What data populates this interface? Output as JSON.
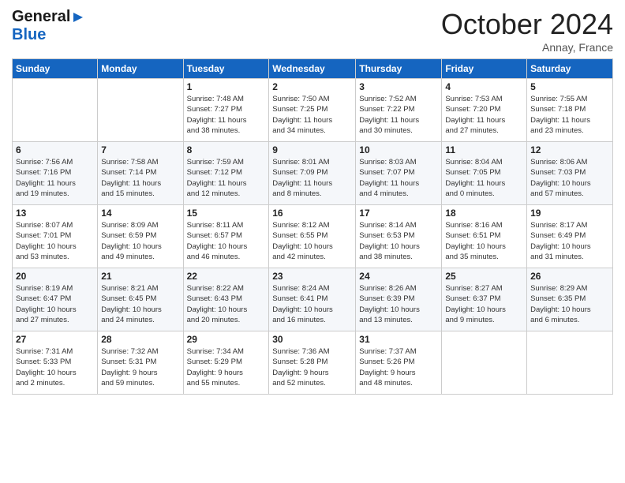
{
  "header": {
    "logo_general": "General",
    "logo_blue": "Blue",
    "month_title": "October 2024",
    "location": "Annay, France"
  },
  "weekdays": [
    "Sunday",
    "Monday",
    "Tuesday",
    "Wednesday",
    "Thursday",
    "Friday",
    "Saturday"
  ],
  "weeks": [
    [
      {
        "day": "",
        "info": ""
      },
      {
        "day": "",
        "info": ""
      },
      {
        "day": "1",
        "info": "Sunrise: 7:48 AM\nSunset: 7:27 PM\nDaylight: 11 hours\nand 38 minutes."
      },
      {
        "day": "2",
        "info": "Sunrise: 7:50 AM\nSunset: 7:25 PM\nDaylight: 11 hours\nand 34 minutes."
      },
      {
        "day": "3",
        "info": "Sunrise: 7:52 AM\nSunset: 7:22 PM\nDaylight: 11 hours\nand 30 minutes."
      },
      {
        "day": "4",
        "info": "Sunrise: 7:53 AM\nSunset: 7:20 PM\nDaylight: 11 hours\nand 27 minutes."
      },
      {
        "day": "5",
        "info": "Sunrise: 7:55 AM\nSunset: 7:18 PM\nDaylight: 11 hours\nand 23 minutes."
      }
    ],
    [
      {
        "day": "6",
        "info": "Sunrise: 7:56 AM\nSunset: 7:16 PM\nDaylight: 11 hours\nand 19 minutes."
      },
      {
        "day": "7",
        "info": "Sunrise: 7:58 AM\nSunset: 7:14 PM\nDaylight: 11 hours\nand 15 minutes."
      },
      {
        "day": "8",
        "info": "Sunrise: 7:59 AM\nSunset: 7:12 PM\nDaylight: 11 hours\nand 12 minutes."
      },
      {
        "day": "9",
        "info": "Sunrise: 8:01 AM\nSunset: 7:09 PM\nDaylight: 11 hours\nand 8 minutes."
      },
      {
        "day": "10",
        "info": "Sunrise: 8:03 AM\nSunset: 7:07 PM\nDaylight: 11 hours\nand 4 minutes."
      },
      {
        "day": "11",
        "info": "Sunrise: 8:04 AM\nSunset: 7:05 PM\nDaylight: 11 hours\nand 0 minutes."
      },
      {
        "day": "12",
        "info": "Sunrise: 8:06 AM\nSunset: 7:03 PM\nDaylight: 10 hours\nand 57 minutes."
      }
    ],
    [
      {
        "day": "13",
        "info": "Sunrise: 8:07 AM\nSunset: 7:01 PM\nDaylight: 10 hours\nand 53 minutes."
      },
      {
        "day": "14",
        "info": "Sunrise: 8:09 AM\nSunset: 6:59 PM\nDaylight: 10 hours\nand 49 minutes."
      },
      {
        "day": "15",
        "info": "Sunrise: 8:11 AM\nSunset: 6:57 PM\nDaylight: 10 hours\nand 46 minutes."
      },
      {
        "day": "16",
        "info": "Sunrise: 8:12 AM\nSunset: 6:55 PM\nDaylight: 10 hours\nand 42 minutes."
      },
      {
        "day": "17",
        "info": "Sunrise: 8:14 AM\nSunset: 6:53 PM\nDaylight: 10 hours\nand 38 minutes."
      },
      {
        "day": "18",
        "info": "Sunrise: 8:16 AM\nSunset: 6:51 PM\nDaylight: 10 hours\nand 35 minutes."
      },
      {
        "day": "19",
        "info": "Sunrise: 8:17 AM\nSunset: 6:49 PM\nDaylight: 10 hours\nand 31 minutes."
      }
    ],
    [
      {
        "day": "20",
        "info": "Sunrise: 8:19 AM\nSunset: 6:47 PM\nDaylight: 10 hours\nand 27 minutes."
      },
      {
        "day": "21",
        "info": "Sunrise: 8:21 AM\nSunset: 6:45 PM\nDaylight: 10 hours\nand 24 minutes."
      },
      {
        "day": "22",
        "info": "Sunrise: 8:22 AM\nSunset: 6:43 PM\nDaylight: 10 hours\nand 20 minutes."
      },
      {
        "day": "23",
        "info": "Sunrise: 8:24 AM\nSunset: 6:41 PM\nDaylight: 10 hours\nand 16 minutes."
      },
      {
        "day": "24",
        "info": "Sunrise: 8:26 AM\nSunset: 6:39 PM\nDaylight: 10 hours\nand 13 minutes."
      },
      {
        "day": "25",
        "info": "Sunrise: 8:27 AM\nSunset: 6:37 PM\nDaylight: 10 hours\nand 9 minutes."
      },
      {
        "day": "26",
        "info": "Sunrise: 8:29 AM\nSunset: 6:35 PM\nDaylight: 10 hours\nand 6 minutes."
      }
    ],
    [
      {
        "day": "27",
        "info": "Sunrise: 7:31 AM\nSunset: 5:33 PM\nDaylight: 10 hours\nand 2 minutes."
      },
      {
        "day": "28",
        "info": "Sunrise: 7:32 AM\nSunset: 5:31 PM\nDaylight: 9 hours\nand 59 minutes."
      },
      {
        "day": "29",
        "info": "Sunrise: 7:34 AM\nSunset: 5:29 PM\nDaylight: 9 hours\nand 55 minutes."
      },
      {
        "day": "30",
        "info": "Sunrise: 7:36 AM\nSunset: 5:28 PM\nDaylight: 9 hours\nand 52 minutes."
      },
      {
        "day": "31",
        "info": "Sunrise: 7:37 AM\nSunset: 5:26 PM\nDaylight: 9 hours\nand 48 minutes."
      },
      {
        "day": "",
        "info": ""
      },
      {
        "day": "",
        "info": ""
      }
    ]
  ]
}
